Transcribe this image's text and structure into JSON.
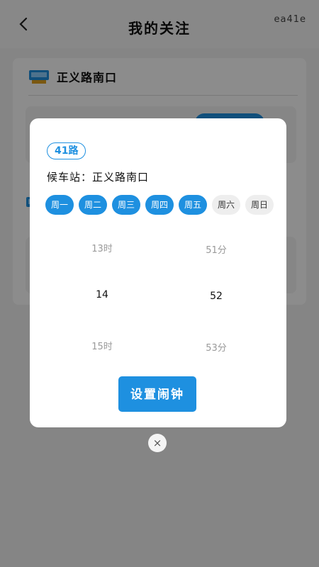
{
  "header": {
    "title": "我的关注",
    "code": "ea41e"
  },
  "background": {
    "stop_name": "正义路南口"
  },
  "modal": {
    "route": "41路",
    "station_label": "候车站：",
    "station_name": "正义路南口",
    "days": [
      {
        "label": "周一",
        "selected": true
      },
      {
        "label": "周二",
        "selected": true
      },
      {
        "label": "周三",
        "selected": true
      },
      {
        "label": "周四",
        "selected": true
      },
      {
        "label": "周五",
        "selected": true
      },
      {
        "label": "周六",
        "selected": false
      },
      {
        "label": "周日",
        "selected": false
      }
    ],
    "hour_prev": "13时",
    "hour_selected": "14",
    "hour_next": "15时",
    "minute_prev": "51分",
    "minute_selected": "52",
    "minute_next": "53分",
    "set_alarm_label": "设置闹钟",
    "close_symbol": "×"
  },
  "colors": {
    "accent": "#1e90e0",
    "overlay": "rgba(0,0,0,0.45)"
  }
}
